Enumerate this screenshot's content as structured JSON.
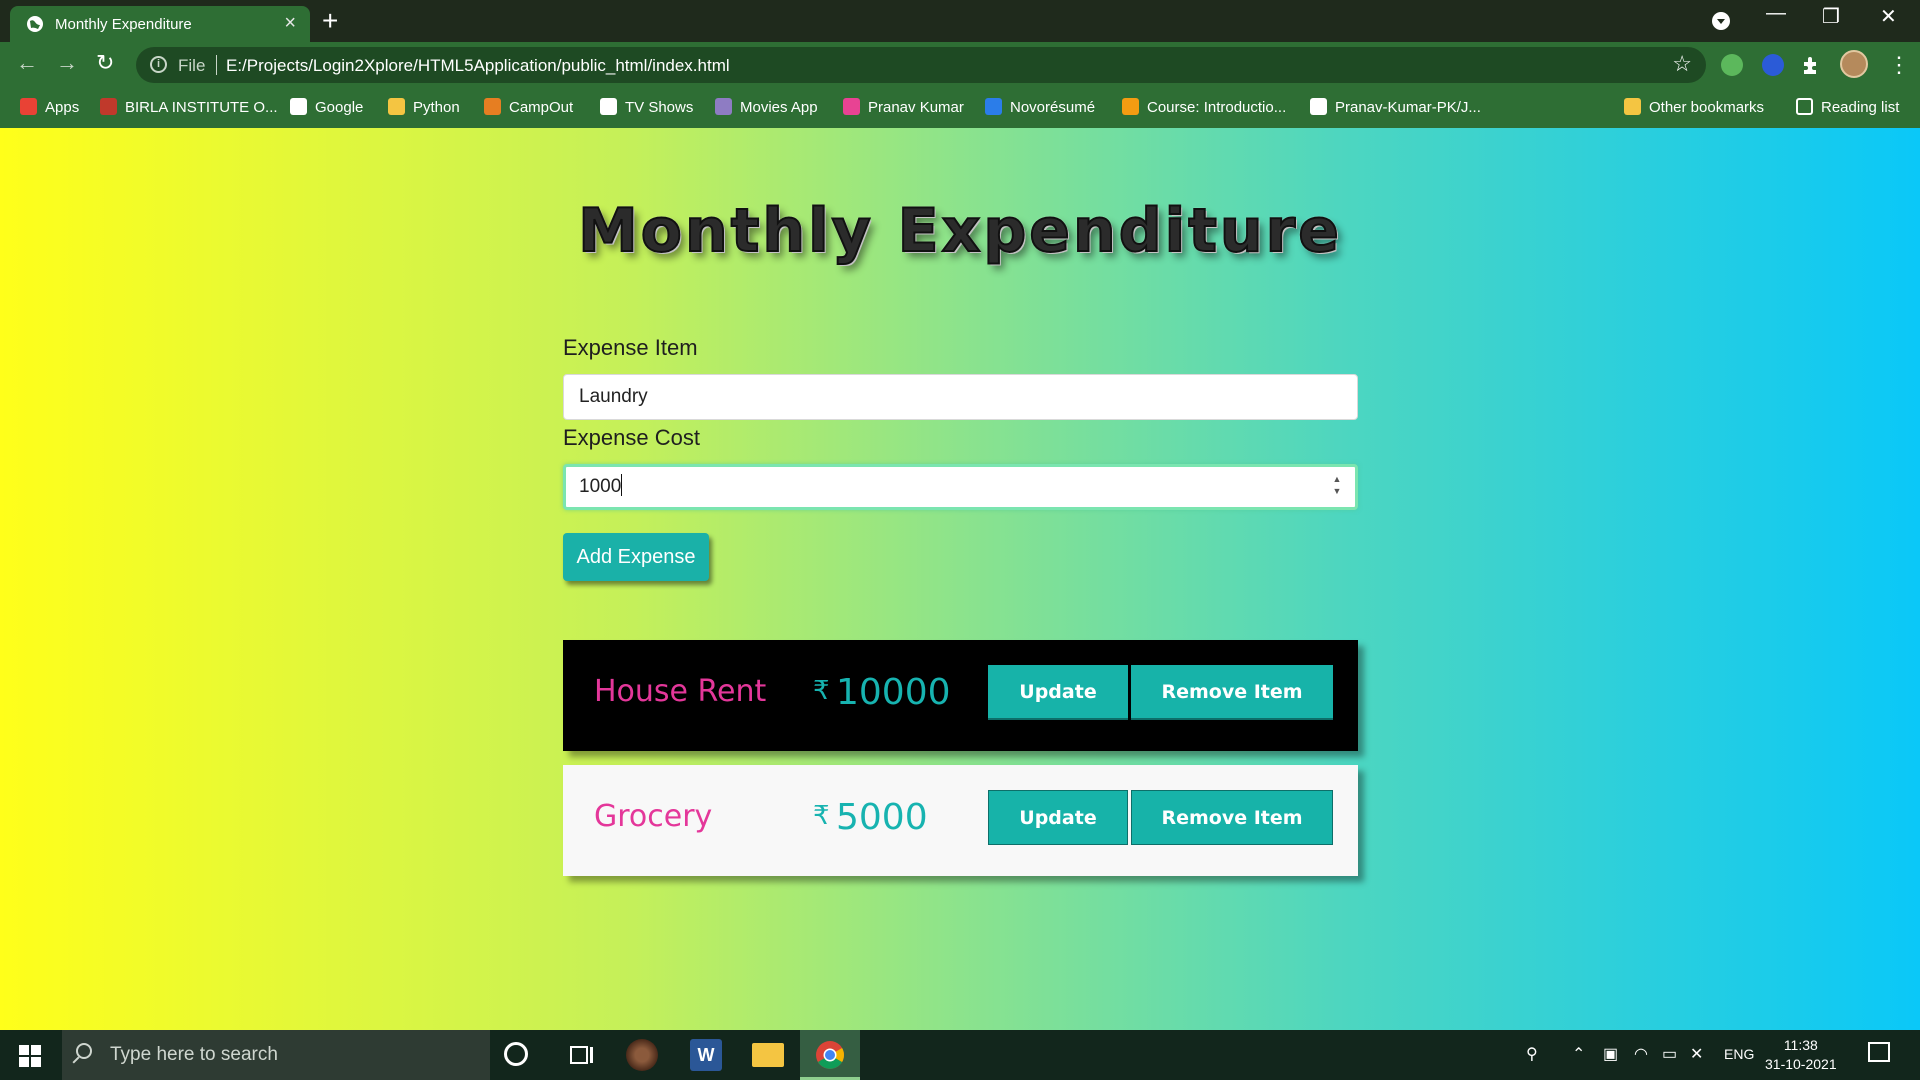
{
  "browser": {
    "tab_title": "Monthly Expenditure",
    "tab_close": "×",
    "new_tab": "+",
    "window_minimize": "—",
    "window_restore": "❐",
    "window_close": "✕",
    "back": "←",
    "forward": "→",
    "reload": "↻",
    "info_glyph": "i",
    "scheme_label": "File",
    "url": "E:/Projects/Login2Xplore/HTML5Application/public_html/index.html",
    "star": "☆",
    "menu": "⋮"
  },
  "bookmarks": [
    {
      "label": "Apps",
      "icon": "apps-grid-icon",
      "color": "#e94235"
    },
    {
      "label": "BIRLA INSTITUTE O...",
      "icon": "birla-icon",
      "color": "#c0392b"
    },
    {
      "label": "Google",
      "icon": "google-icon",
      "color": "#ffffff"
    },
    {
      "label": "Python",
      "icon": "folder-icon",
      "color": "#f4c542"
    },
    {
      "label": "CampOut",
      "icon": "campout-icon",
      "color": "#e67e22"
    },
    {
      "label": "TV Shows",
      "icon": "globe-icon",
      "color": "#ffffff"
    },
    {
      "label": "Movies App",
      "icon": "movies-icon",
      "color": "#8e7cc3"
    },
    {
      "label": "Pranav Kumar",
      "icon": "pk-avatar-icon",
      "color": "#e84393"
    },
    {
      "label": "Novorésumé",
      "icon": "novoresume-icon",
      "color": "#2b7de9"
    },
    {
      "label": "Course: Introductio...",
      "icon": "course-icon",
      "color": "#f39c12"
    },
    {
      "label": "Pranav-Kumar-PK/J...",
      "icon": "github-icon",
      "color": "#ffffff"
    }
  ],
  "bookmarks_right": [
    {
      "label": "Other bookmarks",
      "icon": "folder-icon"
    },
    {
      "label": "Reading list",
      "icon": "reading-list-icon"
    }
  ],
  "page": {
    "title": "Monthly Expenditure",
    "item_label": "Expense Item",
    "item_value": "Laundry",
    "cost_label": "Expense Cost",
    "cost_value": "1000",
    "add_button": "Add Expense",
    "currency": "₹"
  },
  "expenses": [
    {
      "name": "House Rent",
      "amount": "10000",
      "update": "Update",
      "remove": "Remove Item",
      "theme": "dark"
    },
    {
      "name": "Grocery",
      "amount": "5000",
      "update": "Update",
      "remove": "Remove Item",
      "theme": "light"
    }
  ],
  "taskbar": {
    "search_placeholder": "Type here to search",
    "language": "ENG",
    "time": "11:38",
    "date": "31-10-2021"
  },
  "colors": {
    "accent": "#17b3a9",
    "item_name": "#e4379a",
    "chrome": "#2e6e34"
  }
}
